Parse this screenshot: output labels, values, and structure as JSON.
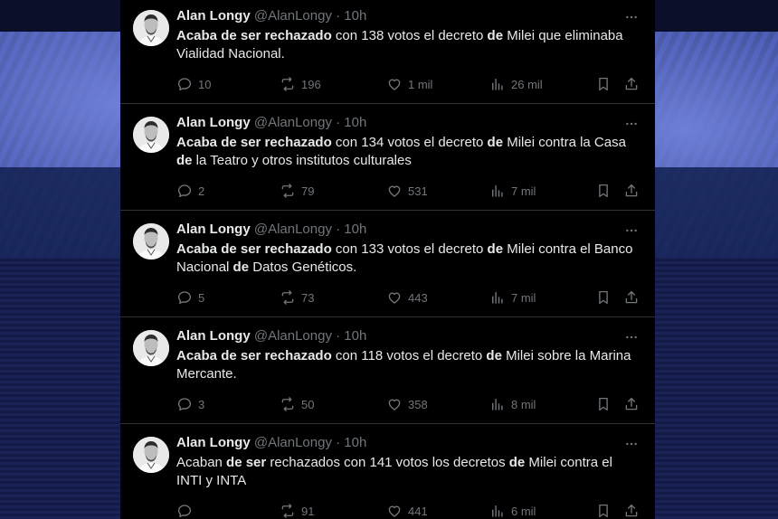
{
  "tweets": [
    {
      "author": "Alan Longy",
      "handle": "@AlanLongy",
      "time": "· 10h",
      "parts": [
        {
          "t": "Acaba de ser rechazado",
          "b": true
        },
        {
          "t": " con 138 votos el decreto ",
          "b": false
        },
        {
          "t": "de",
          "b": true
        },
        {
          "t": " Milei que eliminaba Vialidad Nacional.",
          "b": false
        }
      ],
      "replies": "10",
      "retweets": "196",
      "likes": "1 mil",
      "views": "26 mil"
    },
    {
      "author": "Alan Longy",
      "handle": "@AlanLongy",
      "time": "· 10h",
      "parts": [
        {
          "t": "Acaba de ser rechazado",
          "b": true
        },
        {
          "t": " con 134 votos el decreto ",
          "b": false
        },
        {
          "t": "de",
          "b": true
        },
        {
          "t": " Milei contra la Casa ",
          "b": false
        },
        {
          "t": "de",
          "b": true
        },
        {
          "t": " la Teatro y otros institutos culturales",
          "b": false
        }
      ],
      "replies": "2",
      "retweets": "79",
      "likes": "531",
      "views": "7 mil"
    },
    {
      "author": "Alan Longy",
      "handle": "@AlanLongy",
      "time": "· 10h",
      "parts": [
        {
          "t": "Acaba de ser rechazado",
          "b": true
        },
        {
          "t": " con 133 votos el decreto ",
          "b": false
        },
        {
          "t": "de",
          "b": true
        },
        {
          "t": " Milei contra el Banco Nacional ",
          "b": false
        },
        {
          "t": "de",
          "b": true
        },
        {
          "t": " Datos Genéticos.",
          "b": false
        }
      ],
      "replies": "5",
      "retweets": "73",
      "likes": "443",
      "views": "7 mil"
    },
    {
      "author": "Alan Longy",
      "handle": "@AlanLongy",
      "time": "· 10h",
      "parts": [
        {
          "t": "Acaba de ser rechazado",
          "b": true
        },
        {
          "t": " con 118 votos el decreto ",
          "b": false
        },
        {
          "t": "de",
          "b": true
        },
        {
          "t": " Milei sobre la Marina Mercante.",
          "b": false
        }
      ],
      "replies": "3",
      "retweets": "50",
      "likes": "358",
      "views": "8 mil"
    },
    {
      "author": "Alan Longy",
      "handle": "@AlanLongy",
      "time": "· 10h",
      "parts": [
        {
          "t": "Acaban ",
          "b": false
        },
        {
          "t": "de ser",
          "b": true
        },
        {
          "t": " rechazados con 141 votos los decretos ",
          "b": false
        },
        {
          "t": "de",
          "b": true
        },
        {
          "t": " Milei contra el INTI y INTA",
          "b": false
        }
      ],
      "replies": "",
      "retweets": "91",
      "likes": "441",
      "views": "6 mil"
    }
  ]
}
